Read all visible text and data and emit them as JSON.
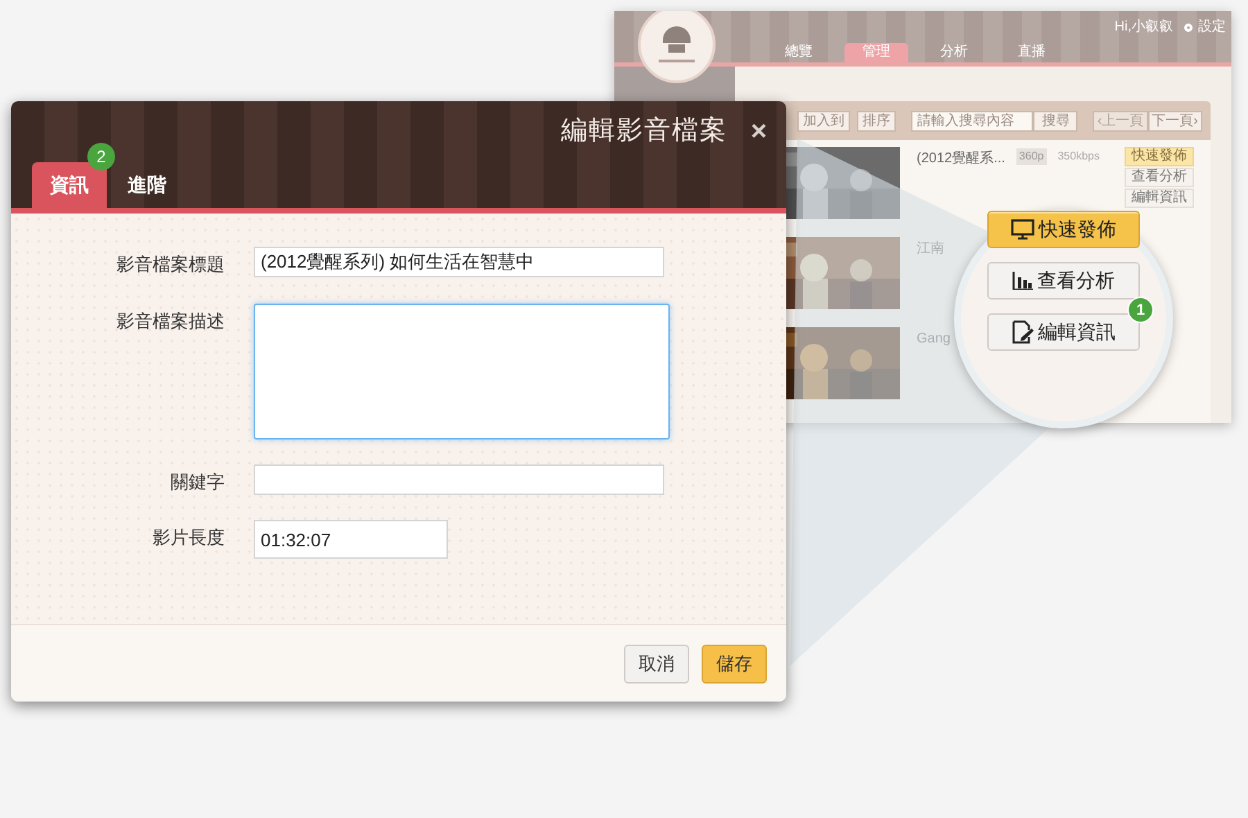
{
  "background_app": {
    "user": "Hi,小叡叡",
    "settings": "設定",
    "nav": [
      {
        "label": "總覽",
        "selected": false
      },
      {
        "label": "管理",
        "selected": true
      },
      {
        "label": "分析",
        "selected": false
      },
      {
        "label": "直播",
        "selected": false
      }
    ],
    "toolbar": {
      "add_button": "加入到",
      "sort_button": "排序",
      "search": {
        "placeholder": "請輸入搜尋內容"
      },
      "search_button": "搜尋",
      "prev_button": "‹上一頁",
      "next_button": "下一頁›"
    },
    "videos": [
      {
        "title": "(2012覺醒系...",
        "quality": "360p",
        "bitrate": "350kbps",
        "actions": [
          "快速發佈",
          "查看分析",
          "編輯資訊"
        ]
      },
      {
        "title": "江南"
      },
      {
        "title": "Gang"
      }
    ]
  },
  "magnifier": {
    "buttons": [
      {
        "label": "快速發佈",
        "kind": "publish"
      },
      {
        "label": "查看分析",
        "kind": "chart"
      },
      {
        "label": "編輯資訊",
        "kind": "edit",
        "badge": "1"
      }
    ]
  },
  "dialog": {
    "title": "編輯影音檔案",
    "close": "×",
    "tabs": [
      {
        "label": "資訊",
        "selected": true,
        "badge": "2"
      },
      {
        "label": "進階",
        "selected": false
      }
    ],
    "fields": [
      {
        "label": "影音檔案標題",
        "kind": "text",
        "value": "(2012覺醒系列) 如何生活在智慧中"
      },
      {
        "label": "影音檔案描述",
        "kind": "textarea",
        "focused": true
      },
      {
        "label": "關鍵字",
        "kind": "text"
      },
      {
        "label": "影片長度",
        "kind": "short",
        "value": "01:32:07"
      }
    ],
    "buttons": [
      {
        "label": "取消",
        "kind": "secondary"
      },
      {
        "label": "儲存",
        "kind": "primary"
      }
    ]
  }
}
